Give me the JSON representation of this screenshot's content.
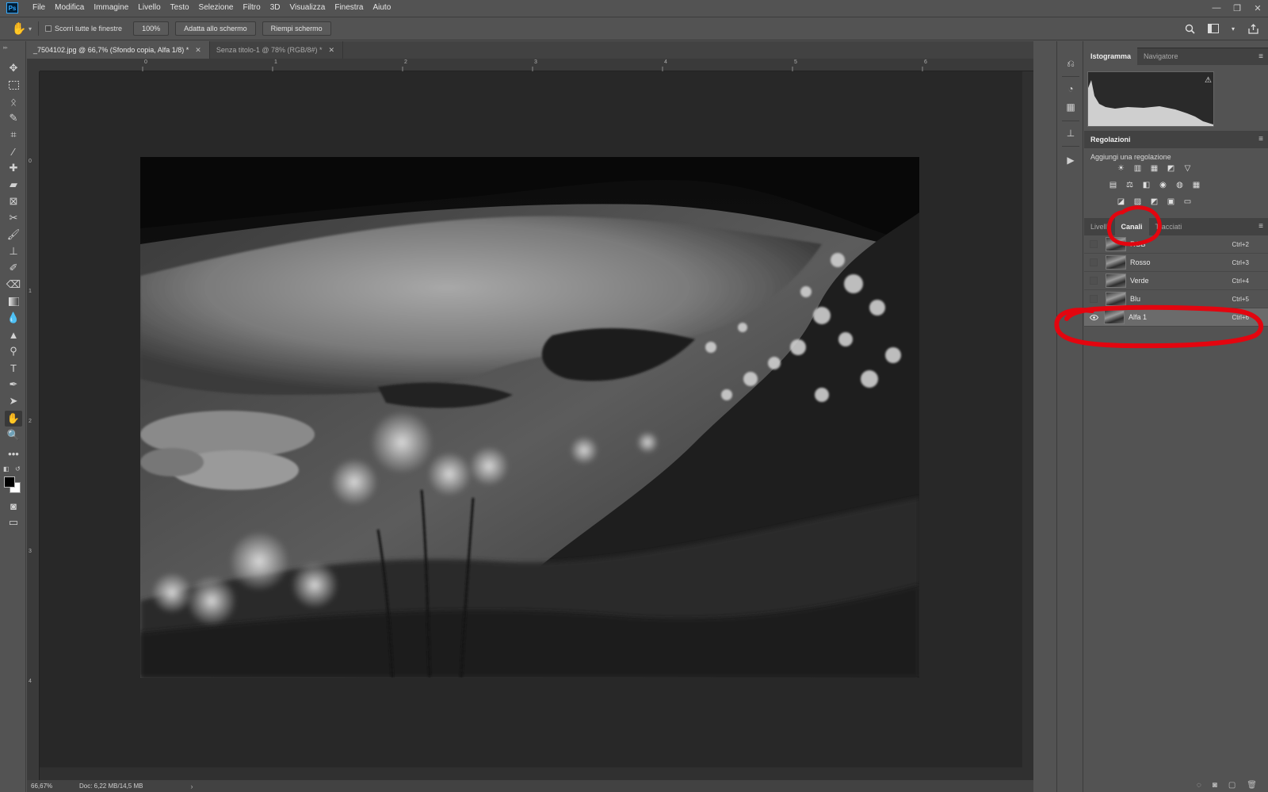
{
  "app": {
    "logo": "Ps",
    "brand_color": "#31a8ff"
  },
  "menu": [
    "File",
    "Modifica",
    "Immagine",
    "Livello",
    "Testo",
    "Selezione",
    "Filtro",
    "3D",
    "Visualizza",
    "Finestra",
    "Aiuto"
  ],
  "window_controls": {
    "minimize": "—",
    "restore": "❐",
    "close": "✕"
  },
  "options_bar": {
    "tool_icon": "hand-icon",
    "scroll_all_label": "Scorri tutte le finestre",
    "scroll_all_checked": false,
    "zoom_value": "100%",
    "fit_screen_label": "Adatta allo schermo",
    "fill_screen_label": "Riempi schermo"
  },
  "doc_tabs": [
    {
      "label": "_7504102.jpg @ 66,7% (Sfondo copia, Alfa 1/8) *",
      "active": true,
      "close": "✕"
    },
    {
      "label": "Senza titolo-1 @ 78% (RGB/8#) *",
      "active": false,
      "close": "✕"
    }
  ],
  "rulers": {
    "top": [
      "0",
      "1",
      "2",
      "3",
      "4",
      "5",
      "6"
    ],
    "left": [
      "0",
      "1",
      "2",
      "3",
      "4"
    ]
  },
  "status": {
    "zoom": "66,67%",
    "doc": "Doc: 6,22 MB/14,5 MB",
    "arrow": "›"
  },
  "panels": {
    "top_tabs": [
      "Istogramma",
      "Navigatore"
    ],
    "histogram_warning": "⚠",
    "adjustments_title": "Regolazioni",
    "adjustments_add": "Aggiungi una regolazione",
    "adjustment_icons_row1": [
      "☀",
      "▥",
      "▦",
      "◩",
      "▽"
    ],
    "adjustment_icons_row2": [
      "▤",
      "⚖",
      "◧",
      "◉",
      "◍",
      "▦"
    ],
    "adjustment_icons_row3": [
      "◪",
      "▨",
      "◩",
      "▣",
      "▭"
    ],
    "channel_tabs": [
      "Livelli",
      "Canali",
      "Tracciati"
    ],
    "menu_icon": "≡",
    "channels": [
      {
        "name": "RGB",
        "shortcut": "Ctrl+2",
        "visible": false,
        "selected": false
      },
      {
        "name": "Rosso",
        "shortcut": "Ctrl+3",
        "visible": false,
        "selected": false
      },
      {
        "name": "Verde",
        "shortcut": "Ctrl+4",
        "visible": false,
        "selected": false
      },
      {
        "name": "Blu",
        "shortcut": "Ctrl+5",
        "visible": false,
        "selected": false
      },
      {
        "name": "Alfa 1",
        "shortcut": "Ctrl+6",
        "visible": true,
        "selected": true
      }
    ],
    "bottom_icons": [
      "◌",
      "◙",
      "▢",
      "🗑"
    ]
  },
  "annotation_color": "#e3050f"
}
